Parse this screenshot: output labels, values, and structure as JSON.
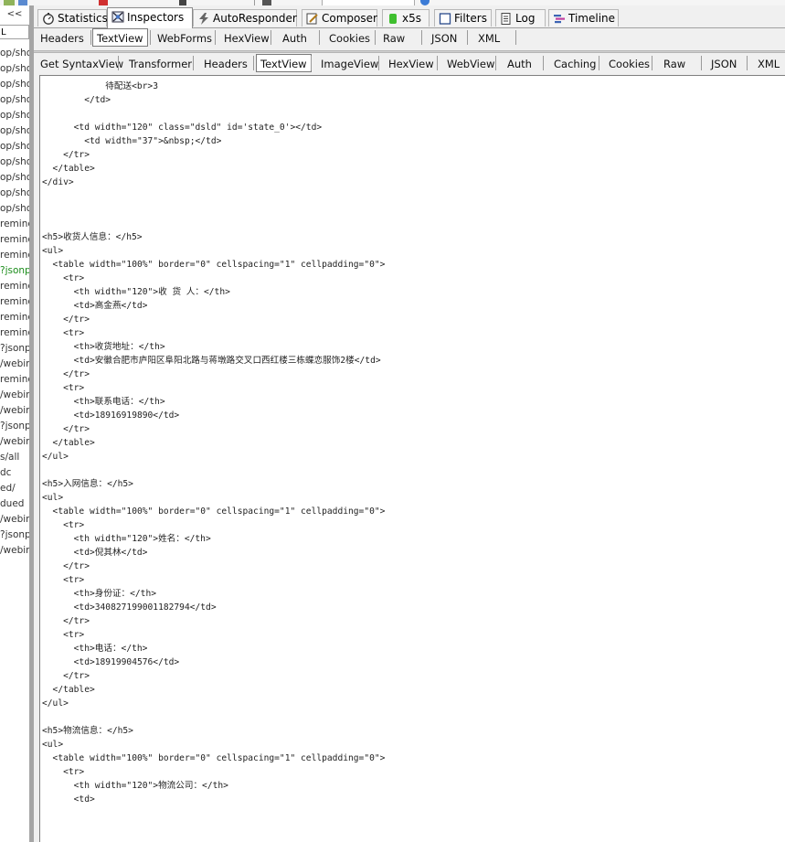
{
  "left_panel": {
    "collapse_label": "<<",
    "filter_value": "L",
    "sessions": [
      {
        "text": "op/sho",
        "color": "normal"
      },
      {
        "text": "op/sho",
        "color": "normal"
      },
      {
        "text": "op/sho",
        "color": "normal"
      },
      {
        "text": "op/sho",
        "color": "normal"
      },
      {
        "text": "op/sho",
        "color": "normal"
      },
      {
        "text": "op/sho",
        "color": "normal"
      },
      {
        "text": "op/sho",
        "color": "normal"
      },
      {
        "text": "op/sho",
        "color": "normal"
      },
      {
        "text": "op/sho",
        "color": "normal"
      },
      {
        "text": "op/sho",
        "color": "normal"
      },
      {
        "text": "op/sho",
        "color": "normal"
      },
      {
        "text": "remind",
        "color": "normal"
      },
      {
        "text": "remind",
        "color": "normal"
      },
      {
        "text": "remind",
        "color": "normal"
      },
      {
        "text": "?jsonp",
        "color": "green"
      },
      {
        "text": "remind",
        "color": "normal"
      },
      {
        "text": "remind",
        "color": "normal"
      },
      {
        "text": "remind",
        "color": "normal"
      },
      {
        "text": "remind",
        "color": "normal"
      },
      {
        "text": "?jsonp",
        "color": "normal"
      },
      {
        "text": "/webim",
        "color": "normal"
      },
      {
        "text": "remind",
        "color": "normal"
      },
      {
        "text": "/webim",
        "color": "normal"
      },
      {
        "text": "/webim",
        "color": "normal"
      },
      {
        "text": "?jsonp",
        "color": "normal"
      },
      {
        "text": "/webim",
        "color": "normal"
      },
      {
        "text": "s/all",
        "color": "normal"
      },
      {
        "text": "dc",
        "color": "normal"
      },
      {
        "text": "ed/",
        "color": "normal"
      },
      {
        "text": "dued",
        "color": "normal"
      },
      {
        "text": "/webim",
        "color": "normal"
      },
      {
        "text": "?jsonp",
        "color": "normal"
      },
      {
        "text": "/webim",
        "color": "normal"
      }
    ]
  },
  "main_tabs": [
    {
      "label": "Statistics",
      "icon": "stopwatch-icon"
    },
    {
      "label": "Inspectors",
      "icon": "inspectors-icon",
      "active": true
    },
    {
      "label": "AutoResponder",
      "icon": "lightning-icon"
    },
    {
      "label": "Composer",
      "icon": "composer-icon"
    },
    {
      "label": "x5s",
      "icon": "x5s-icon"
    },
    {
      "label": "Filters",
      "icon": "checkbox-icon"
    },
    {
      "label": "Log",
      "icon": "log-icon"
    },
    {
      "label": "Timeline",
      "icon": "timeline-icon"
    }
  ],
  "request_tabs": [
    "Headers",
    "TextView",
    "WebForms",
    "HexView",
    "Auth",
    "Cookies",
    "Raw",
    "JSON",
    "XML"
  ],
  "request_active": "TextView",
  "response_tabs": [
    "Get SyntaxView",
    "Transformer",
    "Headers",
    "TextView",
    "ImageView",
    "HexView",
    "WebView",
    "Auth",
    "Caching",
    "Cookies",
    "Raw",
    "JSON",
    "XML"
  ],
  "response_active": "TextView",
  "code_lines": [
    "            待配送<br>3",
    "        </td>",
    "",
    "      <td width=\"120\" class=\"dsld\" id='state_0'></td>",
    "        <td width=\"37\">&nbsp;</td>",
    "    </tr>",
    "  </table>",
    "</div>",
    "",
    "",
    "",
    "<h5>收货人信息：</h5>",
    "<ul>",
    "  <table width=\"100%\" border=\"0\" cellspacing=\"1\" cellpadding=\"0\">",
    "    <tr>",
    "      <th width=\"120\">收 货 人：</th>",
    "      <td>高金燕</td>",
    "    </tr>",
    "    <tr>",
    "      <th>收货地址：</th>",
    "      <td>安徽合肥市庐阳区阜阳北路与蒋墩路交叉口西红楼三栋蝶恋服饰2楼</td>",
    "    </tr>",
    "    <tr>",
    "      <th>联系电话：</th>",
    "      <td>18916919890</td>",
    "    </tr>",
    "  </table>",
    "</ul>",
    "",
    "<h5>入网信息：</h5>",
    "<ul>",
    "  <table width=\"100%\" border=\"0\" cellspacing=\"1\" cellpadding=\"0\">",
    "    <tr>",
    "      <th width=\"120\">姓名：</th>",
    "      <td>倪其林</td>",
    "    </tr>",
    "    <tr>",
    "      <th>身份证：</th>",
    "      <td>340827199001182794</td>",
    "    </tr>",
    "    <tr>",
    "      <th>电话：</th>",
    "      <td>18919904576</td>",
    "    </tr>",
    "  </table>",
    "</ul>",
    "",
    "<h5>物流信息：</h5>",
    "<ul>",
    "  <table width=\"100%\" border=\"0\" cellspacing=\"1\" cellpadding=\"0\">",
    "    <tr>",
    "      <th width=\"120\">物流公司：</th>",
    "      <td>"
  ]
}
